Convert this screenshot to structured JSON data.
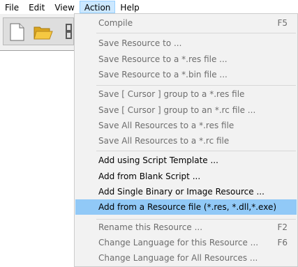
{
  "menubar": {
    "items": [
      {
        "label": "File"
      },
      {
        "label": "Edit"
      },
      {
        "label": "View"
      },
      {
        "label": "Action"
      },
      {
        "label": "Help"
      }
    ]
  },
  "toolbar": {
    "icons": [
      "new-file-icon",
      "open-folder-icon",
      "save-icon"
    ]
  },
  "action_menu": {
    "items": [
      {
        "label": "Compile",
        "shortcut": "F5",
        "enabled": false
      },
      {
        "label": "Save Resource to ...",
        "enabled": false
      },
      {
        "label": "Save Resource to a *.res file ...",
        "enabled": false
      },
      {
        "label": "Save Resource to a *.bin file ...",
        "enabled": false
      },
      {
        "label": "Save [ Cursor ] group to a *.res file",
        "enabled": false
      },
      {
        "label": "Save [ Cursor ] group to an *.rc file ...",
        "enabled": false
      },
      {
        "label": "Save All Resources to a *.res file",
        "enabled": false
      },
      {
        "label": "Save All Resources to a *.rc file",
        "enabled": false
      },
      {
        "label": "Add using Script Template ...",
        "enabled": true
      },
      {
        "label": "Add from Blank Script ...",
        "enabled": true
      },
      {
        "label": "Add Single Binary or Image Resource ...",
        "enabled": true
      },
      {
        "label": "Add from a Resource file (*.res, *.dll,*.exe)",
        "enabled": true,
        "highlighted": true
      },
      {
        "label": "Rename this Resource ...",
        "shortcut": "F2",
        "enabled": false
      },
      {
        "label": "Change Language for this Resource ...",
        "shortcut": "F6",
        "enabled": false
      },
      {
        "label": "Change Language for All Resources ...",
        "enabled": false
      }
    ]
  },
  "colors": {
    "menu_active_bg": "#cce8ff",
    "item_highlight_bg": "#91c9f7",
    "disabled_text": "#6d6d6d"
  }
}
